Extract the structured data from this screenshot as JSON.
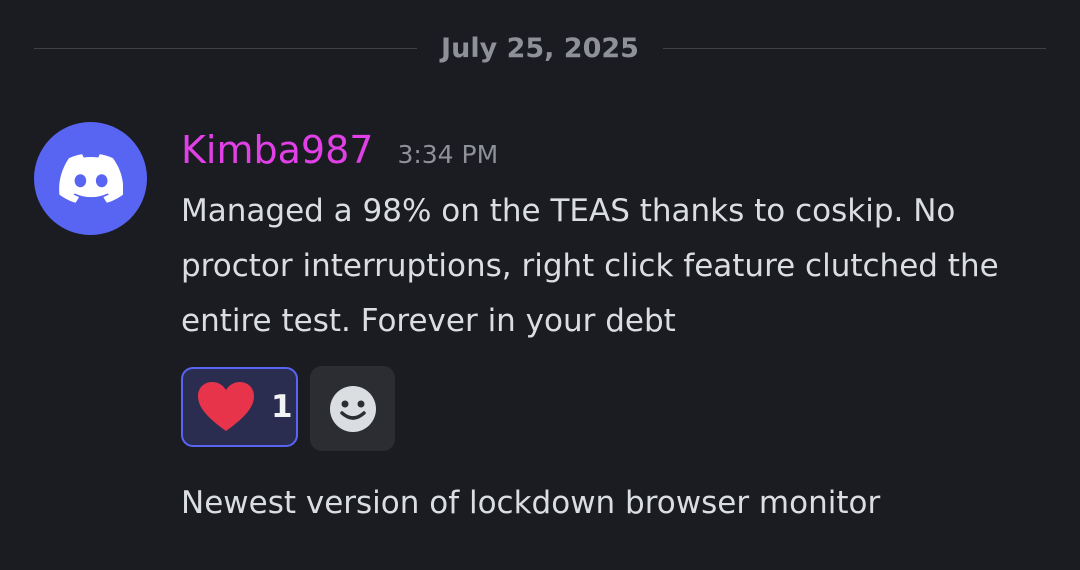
{
  "divider": {
    "date": "July 25, 2025"
  },
  "message": {
    "author": "Kimba987",
    "timestamp": "3:34 PM",
    "avatar_icon": "discord-logo-icon",
    "text": "Managed a 98% on the TEAS thanks to coskip. No proctor interruptions, right click feature clutched the entire test. Forever in your debt",
    "reactions": [
      {
        "emoji": "heart-icon",
        "count": "1"
      }
    ],
    "add_reaction_icon": "smiley-face-icon"
  },
  "next_message": {
    "text": "Newest version of lockdown browser monitor"
  },
  "colors": {
    "background": "#1b1b22",
    "username": "#e040e6",
    "avatar": "#5865f2",
    "reaction_border": "#5865f2",
    "heart": "#e8344a"
  }
}
